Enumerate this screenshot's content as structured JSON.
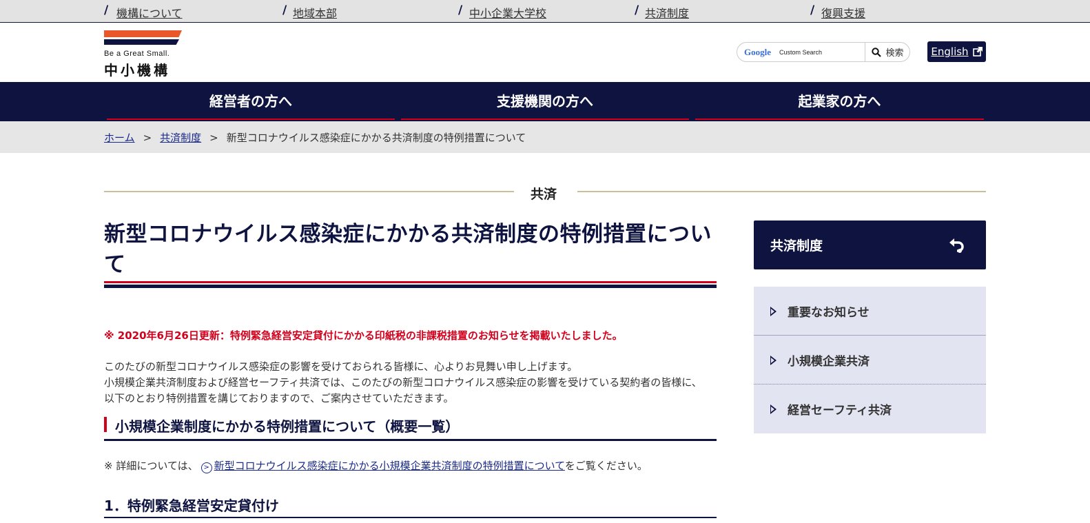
{
  "topbar": {
    "links": [
      "機構について",
      "地域本部",
      "中小企業大学校",
      "共済制度",
      "復興支援"
    ]
  },
  "header": {
    "logo_tagline": "Be a Great Small.",
    "logo_name": "中小機構",
    "search": {
      "google_mark": "Google",
      "placeholder": "Custom Search",
      "button_label": "検索"
    },
    "english_label": "English"
  },
  "mainnav": {
    "items": [
      "経営者の方へ",
      "支援機関の方へ",
      "起業家の方へ"
    ]
  },
  "breadcrumb": {
    "home": "ホーム",
    "section": "共済制度",
    "current": "新型コロナウイルス感染症にかかる共済制度の特例措置について",
    "separator": ">"
  },
  "section_label": "共済",
  "main": {
    "title": "新型コロナウイルス感染症にかかる共済制度の特例措置について",
    "notice": "※ 2020年6月26日更新：特例緊急経営安定貸付にかかる印紙税の非課税措置のお知らせを掲載いたしました。",
    "paragraph1": "このたびの新型コロナウイルス感染症の影響を受けておられる皆様に、心よりお見舞い申し上げます。",
    "paragraph2": "小規模企業共済制度および経営セーフティ共済では、このたびの新型コロナウイルス感染症の影響を受けている契約者の皆様に、以下のとおり特例措置を講じておりますので、ご案内させていただきます。",
    "heading2": "小規模企業制度にかかる特例措置について（概要一覧）",
    "detail_prefix": "※ 詳細については、",
    "detail_link": "新型コロナウイルス感染症にかかる小規模企業共済制度の特例措置について",
    "detail_suffix": "をご覧ください。",
    "heading3": "1．特例緊急経営安定貸付け"
  },
  "sidebar": {
    "title": "共済制度",
    "items": [
      "重要なお知らせ",
      "小規模企業共済",
      "経営セーフティ共済"
    ]
  },
  "colors": {
    "navy": "#0e1340",
    "red": "#d3001c",
    "orange": "#e8582a",
    "sidebar_bg": "#e3e4f2",
    "gold_line": "#c9bf9a"
  }
}
